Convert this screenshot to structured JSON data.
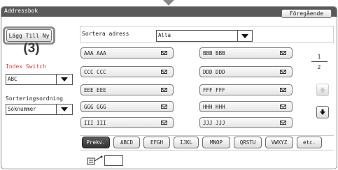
{
  "window": {
    "title": "Addressbok",
    "back_label": "Föregående"
  },
  "actions": {
    "add_new_label": "Lägg Till Ny",
    "callout": "(3)"
  },
  "sort": {
    "label": "Sortera adress",
    "selected": "Alla"
  },
  "index_switch": {
    "label": "Index Switch",
    "selected": "ABC"
  },
  "sort_order": {
    "label": "Sorteringsordning",
    "selected": "Söknummer"
  },
  "entries": [
    {
      "name": "AAA AAA",
      "icon": "email-icon"
    },
    {
      "name": "BBB BBB",
      "icon": "email-icon"
    },
    {
      "name": "CCC CCC",
      "icon": "email-icon"
    },
    {
      "name": "DDD DDD",
      "icon": "email-icon"
    },
    {
      "name": "EEE EEE",
      "icon": "email-icon"
    },
    {
      "name": "FFF FFF",
      "icon": "email-icon"
    },
    {
      "name": "GGG GGG",
      "icon": "email-icon"
    },
    {
      "name": "HHH HHH",
      "icon": "email-icon"
    },
    {
      "name": "III III",
      "icon": "email-icon"
    },
    {
      "name": "JJJ JJJ",
      "icon": "email-icon"
    }
  ],
  "pagination": {
    "current": "1",
    "total": "2"
  },
  "tabs": [
    {
      "label": "Prekv."
    },
    {
      "label": "ABCD"
    },
    {
      "label": "EFGH"
    },
    {
      "label": "IJKL"
    },
    {
      "label": "MNOP"
    },
    {
      "label": "QRSTU"
    },
    {
      "label": "VWXYZ"
    },
    {
      "label": "etc."
    }
  ],
  "colors": {
    "titlebar": "#5a5a5a",
    "index_switch_label": "#d64040",
    "active_tab": "#3a3a3a"
  }
}
